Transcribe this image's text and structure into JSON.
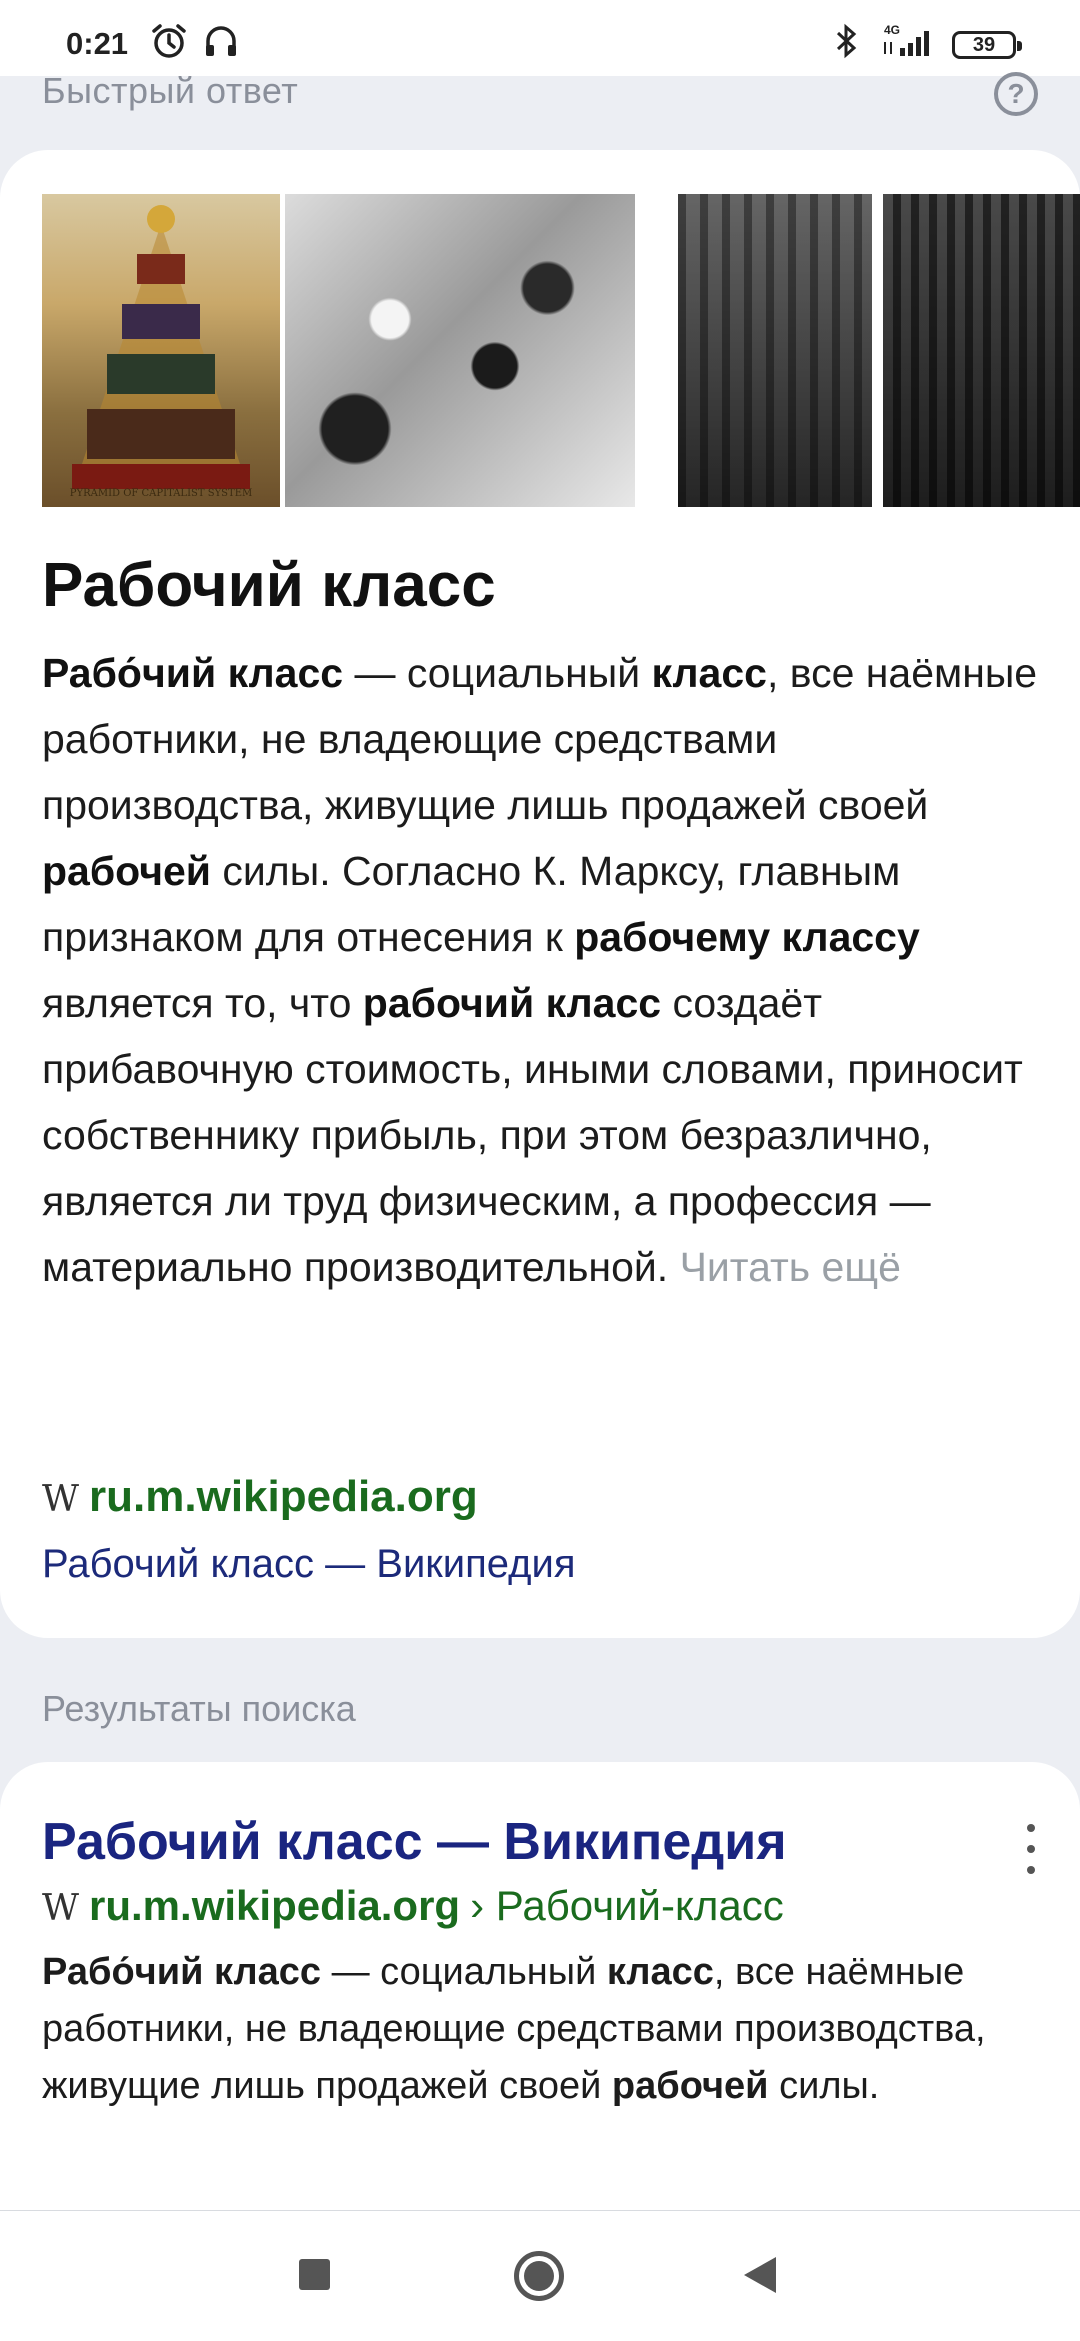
{
  "status_bar": {
    "time": "0:21",
    "network": "4G",
    "battery": "39"
  },
  "quick_answer": {
    "header": "Быстрый ответ",
    "help_symbol": "?",
    "image_caption": "PYRAMID OF CAPITALIST SYSTEM",
    "title": "Рабочий класс",
    "body": [
      {
        "t": "Рабо́чий класс",
        "b": true
      },
      {
        "t": " — социальный ",
        "b": false
      },
      {
        "t": "класс",
        "b": true
      },
      {
        "t": ", все наёмные работники, не владеющие средствами производства, живущие лишь продажей своей ",
        "b": false
      },
      {
        "t": "рабочей",
        "b": true
      },
      {
        "t": " силы. Согласно К. Марксу, главным признаком для отнесения к ",
        "b": false
      },
      {
        "t": "рабочему классу",
        "b": true
      },
      {
        "t": " является то, что ",
        "b": false
      },
      {
        "t": "рабочий класс",
        "b": true
      },
      {
        "t": " создаёт прибавочную стоимость, иными словами, приносит собственнику прибыль, при этом безразлично, является ли труд физическим, а профессия — материально производительной. ",
        "b": false
      }
    ],
    "read_more": "Читать ещё",
    "source_icon": "W",
    "source_domain": "ru.m.wikipedia.org",
    "source_link": "Рабочий класс — Википедия"
  },
  "results": {
    "header": "Результаты поиска",
    "items": [
      {
        "title": "Рабочий класс — Википедия",
        "icon": "W",
        "domain": "ru.m.wikipedia.org",
        "path": "› Рабочий-класс",
        "snippet": [
          {
            "t": "Рабо́чий класс",
            "b": true
          },
          {
            "t": " — социальный ",
            "b": false
          },
          {
            "t": "класс",
            "b": true
          },
          {
            "t": ", все наёмные работники, не владеющие средствами производства, живущие лишь продажей своей ",
            "b": false
          },
          {
            "t": "рабочей",
            "b": true
          },
          {
            "t": " силы.",
            "b": false
          }
        ]
      }
    ]
  },
  "colors": {
    "link_title": "#1a2580",
    "domain_green": "#1a6b1e",
    "muted": "#8a8f9a"
  }
}
